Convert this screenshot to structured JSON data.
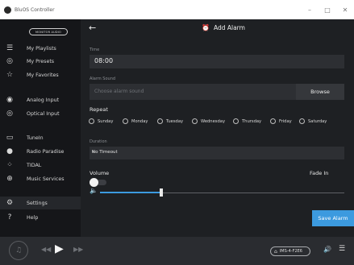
{
  "window": {
    "title": "BluOS Controller",
    "controls": [
      "–",
      "□",
      "✕"
    ]
  },
  "sidebar": {
    "logo": "MONITOR AUDIO",
    "items": [
      {
        "label": "My Playlists",
        "icon": "playlist-icon",
        "glyph": "☰"
      },
      {
        "label": "My Presets",
        "icon": "preset-icon",
        "glyph": "◎"
      },
      {
        "label": "My Favorites",
        "icon": "star-icon",
        "glyph": "☆"
      },
      {
        "label": "Analog Input",
        "icon": "analog-input-icon",
        "glyph": "◉"
      },
      {
        "label": "Optical Input",
        "icon": "optical-input-icon",
        "glyph": "◎"
      },
      {
        "label": "TuneIn",
        "icon": "tunein-icon",
        "glyph": "▭"
      },
      {
        "label": "Radio Paradise",
        "icon": "radio-paradise-icon",
        "glyph": "●"
      },
      {
        "label": "TIDAL",
        "icon": "tidal-icon",
        "glyph": "⁘"
      },
      {
        "label": "Music Services",
        "icon": "music-services-icon",
        "glyph": "⊕"
      },
      {
        "label": "Settings",
        "icon": "settings-gear-icon",
        "glyph": "⚙"
      },
      {
        "label": "Help",
        "icon": "help-icon",
        "glyph": "?"
      }
    ]
  },
  "header": {
    "back_glyph": "←",
    "title": "Add Alarm",
    "title_glyph": "⏰"
  },
  "form": {
    "time_label": "Time",
    "time_value": "08:00",
    "sound_label": "Alarm Sound",
    "sound_placeholder": "Choose alarm sound",
    "browse_label": "Browse",
    "repeat_label": "Repeat",
    "days": [
      "Sunday",
      "Monday",
      "Tuesday",
      "Wednesday",
      "Thursday",
      "Friday",
      "Saturday"
    ],
    "duration_label": "Duration",
    "duration_value": "No Timeout",
    "duration_caret": "▾",
    "volume_label": "Volume",
    "fade_in_label": "Fade In",
    "fade_in_enabled": false,
    "speaker_glyph": "🔈",
    "volume_fraction": 0.25,
    "save_label": "Save Alarm"
  },
  "player": {
    "prev_glyph": "◀◀",
    "play_glyph": "▶",
    "next_glyph": "▶▶",
    "art_glyph": "♫",
    "device_name": "IMS-4-F2E6",
    "device_glyph": "⌂",
    "volume_glyph": "🔊",
    "queue_glyph": "☰"
  },
  "colors": {
    "accent": "#3c9adf",
    "background": "#1e2023",
    "sidebar": "#151619"
  }
}
